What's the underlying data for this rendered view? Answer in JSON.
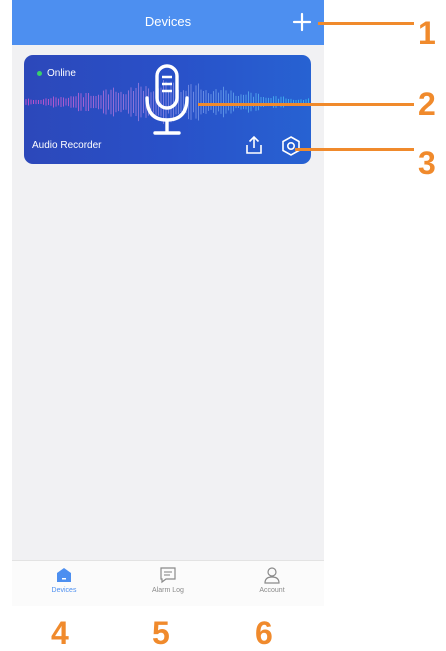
{
  "header": {
    "title": "Devices",
    "add_icon": "plus-icon"
  },
  "device_card": {
    "status": "Online",
    "device_name": "Audio Recorder",
    "status_color": "#3ad06a",
    "icons": {
      "main": "microphone-icon",
      "upload": "upload-icon",
      "settings": "settings-hexagon-icon"
    }
  },
  "tabbar": {
    "tabs": [
      {
        "label": "Devices",
        "icon": "devices-home-icon",
        "active": true
      },
      {
        "label": "Alarm Log",
        "icon": "alarm-log-icon",
        "active": false
      },
      {
        "label": "Account",
        "icon": "account-user-icon",
        "active": false
      }
    ],
    "active_color": "#4d8ff0"
  },
  "callouts": [
    "1",
    "2",
    "3",
    "4",
    "5",
    "6"
  ],
  "colors": {
    "header": "#4d8ff0",
    "callout": "#f08a2c",
    "card_start": "#2c48ba",
    "card_end": "#2762d2"
  }
}
